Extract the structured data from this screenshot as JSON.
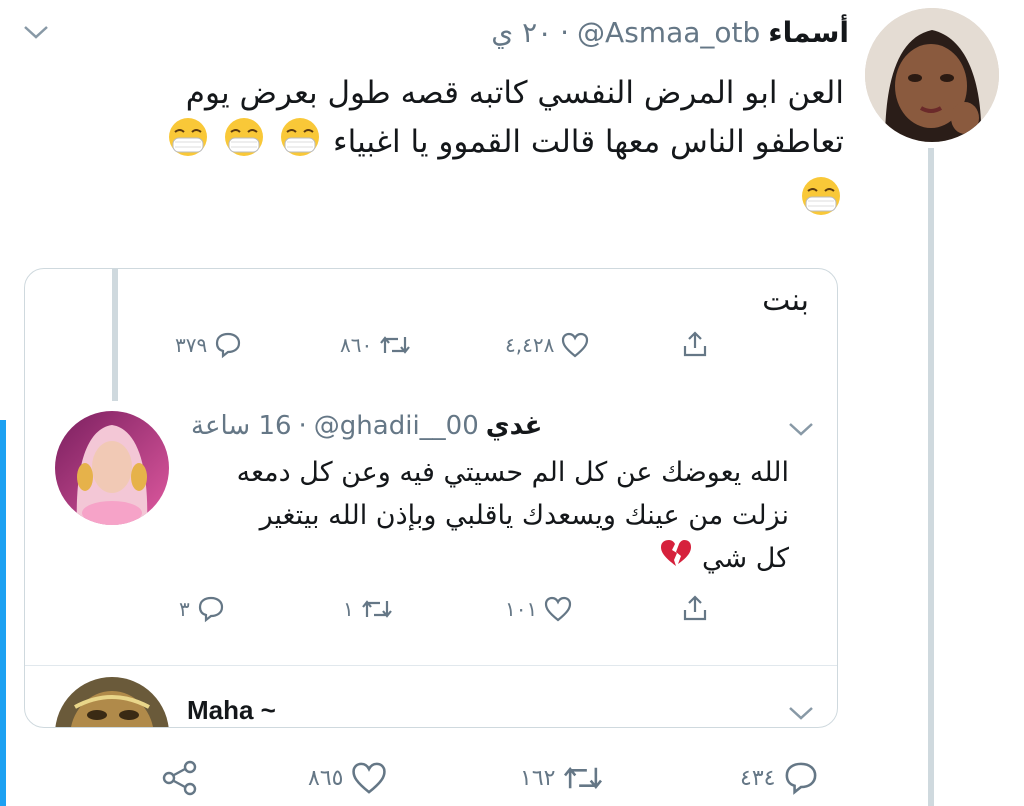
{
  "main_tweet": {
    "display_name": "أسماء",
    "handle": "@Asmaa_otb",
    "separator": "·",
    "date": "٢٠ ي",
    "text_line1": "العن ابو المرض النفسي كاتبه قصه طول بعرض يوم",
    "text_line2": "تعاطفو الناس معها قالت القموو يا اغبياء",
    "emoji": "mask-face",
    "stats": {
      "replies": "٤٣٤",
      "retweets": "١٦٢",
      "likes": "٨٦٥"
    }
  },
  "quoted": {
    "top_text": "بنت",
    "top_stats": {
      "replies": "٣٧٩",
      "retweets": "٨٦٠",
      "likes": "٤,٤٢٨"
    },
    "reply": {
      "display_name": "غدي",
      "handle": "@ghadii__00",
      "separator": "·",
      "time": "16 ساعة",
      "text_line1": "الله يعوضك عن كل الم حسيتي فيه وعن كل دمعه",
      "text_line2": "نزلت من عينك ويسعدك ياقلبي وبإذن الله بيتغير",
      "text_line3": "كل شي",
      "stats": {
        "replies": "٣",
        "retweets": "١",
        "likes": "١٠١"
      }
    },
    "next_reply": {
      "display_name": "Maha ~"
    }
  },
  "colors": {
    "accent_line": "#1da1f2",
    "broken_heart": "#d6213c",
    "mask_yellow": "#f9c838"
  }
}
